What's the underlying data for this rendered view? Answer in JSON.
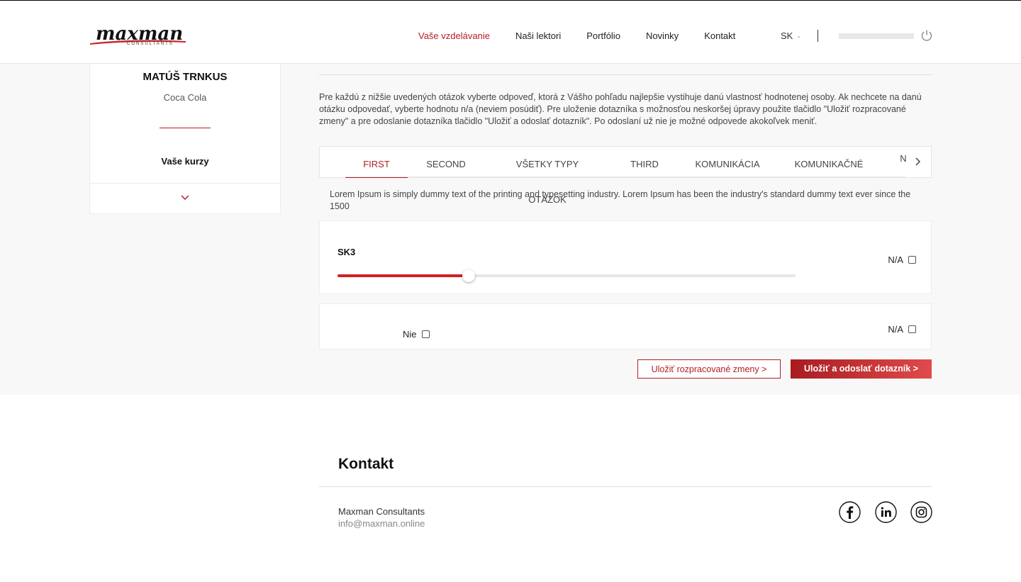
{
  "header": {
    "logo_text": "maxman",
    "logo_sub": "CONSULTANTS",
    "nav": [
      "Vaše vzdelávanie",
      "Naši lektori",
      "Portfólio",
      "Novinky",
      "Kontakt"
    ],
    "language": "SK",
    "accent_color": "#b31e24"
  },
  "sidebar": {
    "name": "MATÚŠ TRNKUS",
    "company": "Coca Cola",
    "courses_label": "Vaše kurzy",
    "toggle_icon": "chevron-down-icon"
  },
  "main": {
    "intro": "Pre každú z nižšie uvedených otázok vyberte odpoveď, ktorá z Vášho pohľadu najlepšie vystihuje danú vlastnosť hodnotenej osoby. Ak nechcete na danú otázku odpovedať, vyberte hodnotu n/a (neviem posúdiť). Pre uloženie dotazníka s možnosťou neskoršej úpravy použite tlačidlo \"Uložiť rozpracované zmeny\" a pre odoslanie dotazníka tlačidlo \"Uložiť a odoslať dotazník\". Po odoslaní už nie je možné odpovede akokoľvek meniť.",
    "tabs": [
      "FIRST",
      "SECOND",
      "VŠETKY TYPY OTÁZOK",
      "THIRD",
      "KOMUNIKÁCIA",
      "KOMUNIKAČNÉ",
      "N"
    ],
    "active_tab": "FIRST",
    "description": "Lorem Ipsum is simply dummy text of the printing and typesetting industry. Lorem Ipsum has been the industry's standard dummy text ever since the 1500",
    "question1": {
      "label": "SK3",
      "slider_value": 0.287,
      "na_label": "N/A"
    },
    "question2": {
      "option_label": "Nie",
      "na_label": "N/A"
    },
    "save_draft_label": "Uložiť rozpracované zmeny >",
    "submit_label": "Uložiť a odoslať dotazník >"
  },
  "footer": {
    "title": "Kontakt",
    "company": "Maxman Consultants",
    "email": "info@maxman.online",
    "social": [
      "facebook-icon",
      "linkedin-icon",
      "instagram-icon"
    ]
  }
}
